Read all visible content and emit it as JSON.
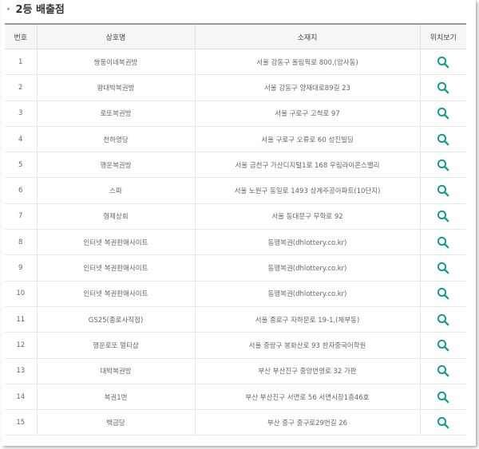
{
  "section_title": "2등 배출점",
  "headers": [
    "번호",
    "상호명",
    "소재지",
    "위치보기"
  ],
  "accent_color": "#1a9c8c",
  "icon": "search-icon",
  "rows": [
    {
      "no": "1",
      "name": "쌍둥이네복권방",
      "address": "서울 강동구 올림픽로 800,(암사동)"
    },
    {
      "no": "2",
      "name": "왕대박복권방",
      "address": "서울 강동구 양재대로89길 23"
    },
    {
      "no": "3",
      "name": "로또복권방",
      "address": "서울 구로구 고척로 97"
    },
    {
      "no": "4",
      "name": "천하명당",
      "address": "서울 구로구 오류로 60 성진빌딩"
    },
    {
      "no": "5",
      "name": "행운복권방",
      "address": "서울 금천구 가산디지털1로 168 우림라이온스밸리"
    },
    {
      "no": "6",
      "name": "스파",
      "address": "서울 노원구 동일로 1493 상계주공아파트(10단지)"
    },
    {
      "no": "7",
      "name": "형제상회",
      "address": "서울 동대문구 무학로 92"
    },
    {
      "no": "8",
      "name": "인터넷 복권판매사이트",
      "address": "동행복권(dhlottery.co.kr)"
    },
    {
      "no": "9",
      "name": "인터넷 복권판매사이트",
      "address": "동행복권(dhlottery.co.kr)"
    },
    {
      "no": "10",
      "name": "인터넷 복권판매사이트",
      "address": "동행복권(dhlottery.co.kr)"
    },
    {
      "no": "11",
      "name": "GS25(종로사직점)",
      "address": "서울 종로구 자하문로 19-1,(체부동)"
    },
    {
      "no": "12",
      "name": "행운로또 멀티샵",
      "address": "서울 중랑구 봉화산로 93 한자중국어학원"
    },
    {
      "no": "13",
      "name": "대박복권방",
      "address": "부산 부산진구 중앙번영로 32 가판"
    },
    {
      "no": "14",
      "name": "복권1번",
      "address": "부산 부산진구 서면로 56 서면시장1층46호"
    },
    {
      "no": "15",
      "name": "백금당",
      "address": "부산 중구 중구로29번길 26"
    }
  ]
}
